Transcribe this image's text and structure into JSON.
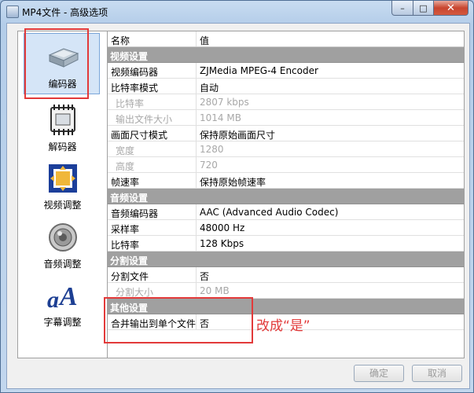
{
  "window": {
    "title": "MP4文件 - 高级选项",
    "controls": {
      "minimize": "–",
      "maximize": "□",
      "close": "✕"
    }
  },
  "sidebar": {
    "items": [
      {
        "label": "编码器",
        "icon": "encoder-device-icon",
        "selected": true
      },
      {
        "label": "解码器",
        "icon": "decoder-chip-icon",
        "selected": false
      },
      {
        "label": "视频调整",
        "icon": "video-adjust-icon",
        "selected": false
      },
      {
        "label": "音频调整",
        "icon": "speaker-icon",
        "selected": false
      },
      {
        "label": "字幕调整",
        "icon": "subtitle-letter-a-icon",
        "selected": false
      }
    ]
  },
  "grid": {
    "headers": {
      "name": "名称",
      "value": "值"
    },
    "rows": [
      {
        "type": "section",
        "name": "视频设置",
        "value": ""
      },
      {
        "type": "prop",
        "name": "视频编码器",
        "value": "ZJMedia MPEG-4 Encoder"
      },
      {
        "type": "prop",
        "name": "比特率模式",
        "value": "自动"
      },
      {
        "type": "sub",
        "name": "比特率",
        "value": "2807 kbps"
      },
      {
        "type": "sub",
        "name": "输出文件大小",
        "value": "1014 MB"
      },
      {
        "type": "prop",
        "name": "画面尺寸模式",
        "value": "保持原始画面尺寸"
      },
      {
        "type": "sub",
        "name": "宽度",
        "value": "1280"
      },
      {
        "type": "sub",
        "name": "高度",
        "value": "720"
      },
      {
        "type": "prop",
        "name": "帧速率",
        "value": "保持原始帧速率"
      },
      {
        "type": "section",
        "name": "音频设置",
        "value": ""
      },
      {
        "type": "prop",
        "name": "音频编码器",
        "value": "AAC (Advanced Audio Codec)"
      },
      {
        "type": "prop",
        "name": "采样率",
        "value": "48000 Hz"
      },
      {
        "type": "prop",
        "name": "比特率",
        "value": "128 Kbps"
      },
      {
        "type": "section",
        "name": "分割设置",
        "value": ""
      },
      {
        "type": "prop",
        "name": "分割文件",
        "value": "否"
      },
      {
        "type": "sub",
        "name": "分割大小",
        "value": "20 MB"
      },
      {
        "type": "section",
        "name": "其他设置",
        "value": ""
      },
      {
        "type": "prop",
        "name": "合并输出到单个文件",
        "value": "否"
      }
    ]
  },
  "annotation": {
    "text": "改成“是”",
    "color": "#e23a3a"
  },
  "buttons": {
    "ok": "确定",
    "cancel": "取消"
  },
  "colors": {
    "section_bg": "#a0a0a0",
    "selection": "#d5e5f7",
    "annotation_red": "#e23a3a"
  }
}
